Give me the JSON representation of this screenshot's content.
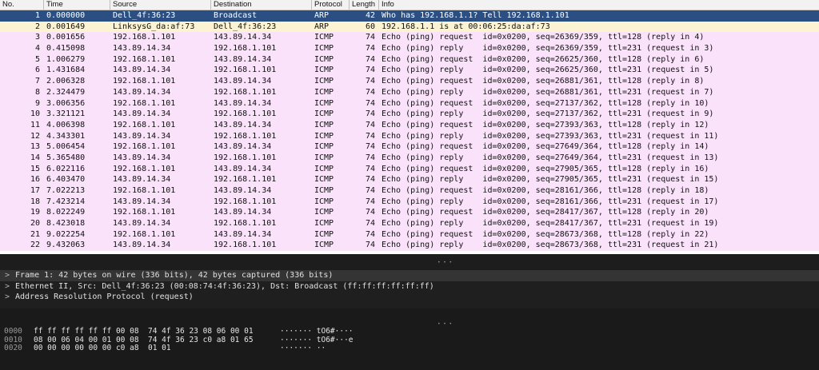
{
  "columns": {
    "no": "No.",
    "time": "Time",
    "source": "Source",
    "destination": "Destination",
    "protocol": "Protocol",
    "length": "Length",
    "info": "Info"
  },
  "packets": [
    {
      "no": "1",
      "time": "0.000000",
      "src": "Dell_4f:36:23",
      "dst": "Broadcast",
      "proto": "ARP",
      "len": "42",
      "info": "Who has 192.168.1.1? Tell 192.168.1.101"
    },
    {
      "no": "2",
      "time": "0.001649",
      "src": "LinksysG_da:af:73",
      "dst": "Dell_4f:36:23",
      "proto": "ARP",
      "len": "60",
      "info": "192.168.1.1 is at 00:06:25:da:af:73"
    },
    {
      "no": "3",
      "time": "0.001656",
      "src": "192.168.1.101",
      "dst": "143.89.14.34",
      "proto": "ICMP",
      "len": "74",
      "info": "Echo (ping) request  id=0x0200, seq=26369/359, ttl=128 (reply in 4)"
    },
    {
      "no": "4",
      "time": "0.415098",
      "src": "143.89.14.34",
      "dst": "192.168.1.101",
      "proto": "ICMP",
      "len": "74",
      "info": "Echo (ping) reply    id=0x0200, seq=26369/359, ttl=231 (request in 3)"
    },
    {
      "no": "5",
      "time": "1.006279",
      "src": "192.168.1.101",
      "dst": "143.89.14.34",
      "proto": "ICMP",
      "len": "74",
      "info": "Echo (ping) request  id=0x0200, seq=26625/360, ttl=128 (reply in 6)"
    },
    {
      "no": "6",
      "time": "1.431684",
      "src": "143.89.14.34",
      "dst": "192.168.1.101",
      "proto": "ICMP",
      "len": "74",
      "info": "Echo (ping) reply    id=0x0200, seq=26625/360, ttl=231 (request in 5)"
    },
    {
      "no": "7",
      "time": "2.006328",
      "src": "192.168.1.101",
      "dst": "143.89.14.34",
      "proto": "ICMP",
      "len": "74",
      "info": "Echo (ping) request  id=0x0200, seq=26881/361, ttl=128 (reply in 8)"
    },
    {
      "no": "8",
      "time": "2.324479",
      "src": "143.89.14.34",
      "dst": "192.168.1.101",
      "proto": "ICMP",
      "len": "74",
      "info": "Echo (ping) reply    id=0x0200, seq=26881/361, ttl=231 (request in 7)"
    },
    {
      "no": "9",
      "time": "3.006356",
      "src": "192.168.1.101",
      "dst": "143.89.14.34",
      "proto": "ICMP",
      "len": "74",
      "info": "Echo (ping) request  id=0x0200, seq=27137/362, ttl=128 (reply in 10)"
    },
    {
      "no": "10",
      "time": "3.321121",
      "src": "143.89.14.34",
      "dst": "192.168.1.101",
      "proto": "ICMP",
      "len": "74",
      "info": "Echo (ping) reply    id=0x0200, seq=27137/362, ttl=231 (request in 9)"
    },
    {
      "no": "11",
      "time": "4.006398",
      "src": "192.168.1.101",
      "dst": "143.89.14.34",
      "proto": "ICMP",
      "len": "74",
      "info": "Echo (ping) request  id=0x0200, seq=27393/363, ttl=128 (reply in 12)"
    },
    {
      "no": "12",
      "time": "4.343301",
      "src": "143.89.14.34",
      "dst": "192.168.1.101",
      "proto": "ICMP",
      "len": "74",
      "info": "Echo (ping) reply    id=0x0200, seq=27393/363, ttl=231 (request in 11)"
    },
    {
      "no": "13",
      "time": "5.006454",
      "src": "192.168.1.101",
      "dst": "143.89.14.34",
      "proto": "ICMP",
      "len": "74",
      "info": "Echo (ping) request  id=0x0200, seq=27649/364, ttl=128 (reply in 14)"
    },
    {
      "no": "14",
      "time": "5.365480",
      "src": "143.89.14.34",
      "dst": "192.168.1.101",
      "proto": "ICMP",
      "len": "74",
      "info": "Echo (ping) reply    id=0x0200, seq=27649/364, ttl=231 (request in 13)"
    },
    {
      "no": "15",
      "time": "6.022116",
      "src": "192.168.1.101",
      "dst": "143.89.14.34",
      "proto": "ICMP",
      "len": "74",
      "info": "Echo (ping) request  id=0x0200, seq=27905/365, ttl=128 (reply in 16)"
    },
    {
      "no": "16",
      "time": "6.403470",
      "src": "143.89.14.34",
      "dst": "192.168.1.101",
      "proto": "ICMP",
      "len": "74",
      "info": "Echo (ping) reply    id=0x0200, seq=27905/365, ttl=231 (request in 15)"
    },
    {
      "no": "17",
      "time": "7.022213",
      "src": "192.168.1.101",
      "dst": "143.89.14.34",
      "proto": "ICMP",
      "len": "74",
      "info": "Echo (ping) request  id=0x0200, seq=28161/366, ttl=128 (reply in 18)"
    },
    {
      "no": "18",
      "time": "7.423214",
      "src": "143.89.14.34",
      "dst": "192.168.1.101",
      "proto": "ICMP",
      "len": "74",
      "info": "Echo (ping) reply    id=0x0200, seq=28161/366, ttl=231 (request in 17)"
    },
    {
      "no": "19",
      "time": "8.022249",
      "src": "192.168.1.101",
      "dst": "143.89.14.34",
      "proto": "ICMP",
      "len": "74",
      "info": "Echo (ping) request  id=0x0200, seq=28417/367, ttl=128 (reply in 20)"
    },
    {
      "no": "20",
      "time": "8.423018",
      "src": "143.89.14.34",
      "dst": "192.168.1.101",
      "proto": "ICMP",
      "len": "74",
      "info": "Echo (ping) reply    id=0x0200, seq=28417/367, ttl=231 (request in 19)"
    },
    {
      "no": "21",
      "time": "9.022254",
      "src": "192.168.1.101",
      "dst": "143.89.14.34",
      "proto": "ICMP",
      "len": "74",
      "info": "Echo (ping) request  id=0x0200, seq=28673/368, ttl=128 (reply in 22)"
    },
    {
      "no": "22",
      "time": "9.432063",
      "src": "143.89.14.34",
      "dst": "192.168.1.101",
      "proto": "ICMP",
      "len": "74",
      "info": "Echo (ping) reply    id=0x0200, seq=28673/368, ttl=231 (request in 21)"
    }
  ],
  "details": [
    "Frame 1: 42 bytes on wire (336 bits), 42 bytes captured (336 bits)",
    "Ethernet II, Src: Dell_4f:36:23 (00:08:74:4f:36:23), Dst: Broadcast (ff:ff:ff:ff:ff:ff)",
    "Address Resolution Protocol (request)"
  ],
  "expand_glyph": ">",
  "grip_glyph": "• • •",
  "bytes": [
    {
      "offset": "0000",
      "hex": "ff ff ff ff ff ff 00 08  74 4f 36 23 08 06 00 01",
      "ascii": "······· tO6#····"
    },
    {
      "offset": "0010",
      "hex": "08 00 06 04 00 01 00 08  74 4f 36 23 c0 a8 01 65",
      "ascii": "······· tO6#···e"
    },
    {
      "offset": "0020",
      "hex": "00 00 00 00 00 00 c0 a8  01 01",
      "ascii": "······· ··"
    }
  ],
  "colors": {
    "selected_row": "#2b4f82",
    "arp_row": "#fbf3d2",
    "icmp_row": "#fbe2fb",
    "dark_pane": "#1f1f1f"
  }
}
